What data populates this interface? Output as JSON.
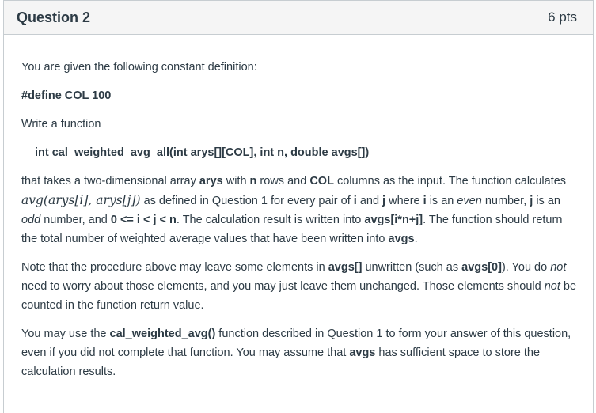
{
  "header": {
    "title": "Question 2",
    "points": "6 pts"
  },
  "body": {
    "intro": "You are given the following constant definition:",
    "define": "#define COL 100",
    "write": "Write a function",
    "signature": "int cal_weighted_avg_all(int arys[][COL], int n, double avgs[])",
    "main": {
      "t1": "that takes a two-dimensional array ",
      "b1": "arys",
      "t2": " with ",
      "b2": "n",
      "t3": " rows and ",
      "b3": "COL",
      "t4": " columns as the input. The function calculates ",
      "math": "avg(arys[i], arys[j])",
      "t5": " as defined in Question 1 for every pair of ",
      "b4": "i",
      "t6": " and ",
      "b5": "j",
      "t7": " where ",
      "b6": "i",
      "t8": " is an ",
      "i1": "even",
      "t9": " number, ",
      "b7": "j",
      "t10": " is an ",
      "i2": "odd",
      "t11": " number, and ",
      "b8": "0 <= i < j < n",
      "t12": ". The calculation result is written into ",
      "b9": "avgs[i*n+j]",
      "t13": ". The function should return the total number of weighted average values that have been written into ",
      "b10": "avgs",
      "t14": "."
    },
    "note": {
      "t1": "Note that the procedure above may leave some elements in ",
      "b1": "avgs[]",
      "t2": " unwritten (such as ",
      "b2": "avgs[0]",
      "t3": "). You do ",
      "i1": "not",
      "t4": " need to worry about those elements, and you may just leave them unchanged. Those elements should ",
      "i2": "not",
      "t5": " be counted in the function return value."
    },
    "final": {
      "t1": "You may use the ",
      "b1": "cal_weighted_avg()",
      "t2": " function described in Question 1 to form your answer of this question, even if you did not complete that function. You may assume that ",
      "b2": "avgs",
      "t3": " has sufficient space to store the calculation results."
    }
  }
}
